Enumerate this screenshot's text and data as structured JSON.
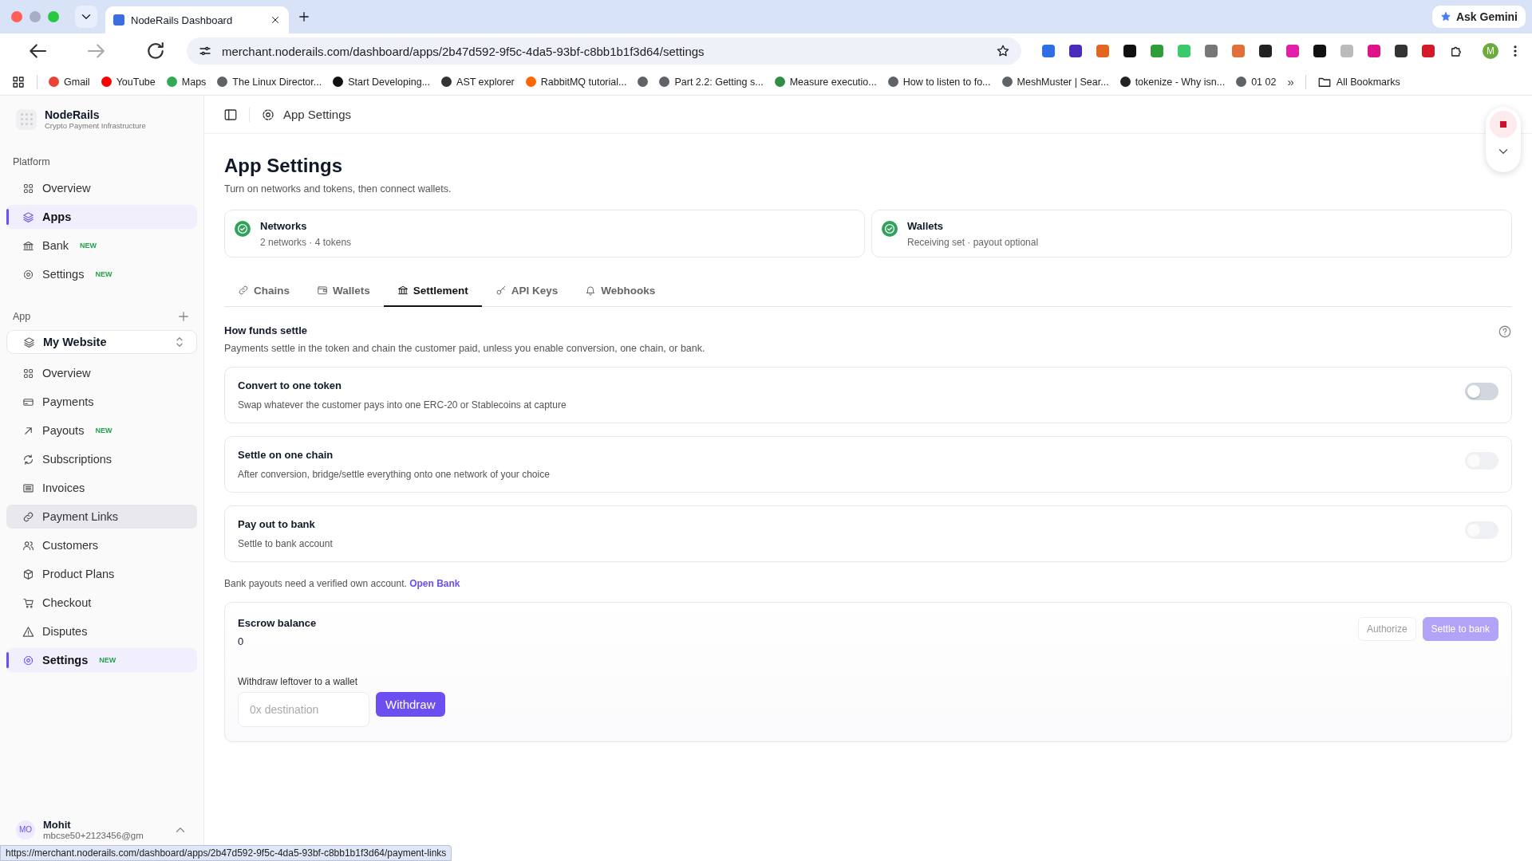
{
  "browser": {
    "tabs": [
      {
        "title": "NodeRails Dashboard",
        "selected": true
      }
    ],
    "url": "merchant.noderails.com/dashboard/apps/2b47d592-9f5c-4da5-93bf-c8bb1b1f3d64/settings",
    "ask_button": "Ask Gemini",
    "profile": "M",
    "bookmarks": [
      {
        "label": "Gmail",
        "color": "#ea4335"
      },
      {
        "label": "YouTube",
        "color": "#ff0000"
      },
      {
        "label": "Maps",
        "color": "#34a853"
      },
      {
        "label": "The Linux Director...",
        "color": "#5f6368"
      },
      {
        "label": "Start Developing...",
        "color": "#111111"
      },
      {
        "label": "AST explorer",
        "color": "#333333"
      },
      {
        "label": "RabbitMQ tutorial...",
        "color": "#ff6600"
      },
      {
        "color": "#5f6368"
      },
      {
        "label": "Part 2.2: Getting s...",
        "color": "#5f6368"
      },
      {
        "label": "Measure executio...",
        "color": "#2f8d46"
      },
      {
        "label": "How to listen to fo...",
        "color": "#5f6368"
      },
      {
        "label": "MeshMuster | Sear...",
        "color": "#5f6368"
      },
      {
        "label": "tokenize - Why isn...",
        "color": "#222222"
      },
      {
        "label": "01 02",
        "color": "#5f6368"
      }
    ],
    "overflow": "»",
    "all_bookmarks": "All Bookmarks"
  },
  "sidebar": {
    "brand": {
      "name": "NodeRails",
      "tagline": "Crypto Payment Infrastructure"
    },
    "platform": {
      "heading": "Platform",
      "items": [
        {
          "label": "Overview",
          "selected": false,
          "hovered": false
        },
        {
          "label": "Apps",
          "selected": true,
          "hovered": false
        },
        {
          "label": "Bank",
          "badge": "NEW",
          "selected": false,
          "hovered": false
        },
        {
          "label": "Settings",
          "badge": "NEW",
          "selected": false,
          "hovered": false
        }
      ]
    },
    "app": {
      "heading": "App",
      "selector": "My Website",
      "items": [
        {
          "label": "Overview",
          "selected": false,
          "hovered": false
        },
        {
          "label": "Payments",
          "selected": false,
          "hovered": false
        },
        {
          "label": "Payouts",
          "badge": "NEW",
          "selected": false,
          "hovered": false
        },
        {
          "label": "Subscriptions",
          "selected": false,
          "hovered": false
        },
        {
          "label": "Invoices",
          "selected": false,
          "hovered": false
        },
        {
          "label": "Payment Links",
          "selected": false,
          "hovered": true
        },
        {
          "label": "Customers",
          "selected": false,
          "hovered": false
        },
        {
          "label": "Product Plans",
          "selected": false,
          "hovered": false
        },
        {
          "label": "Checkout",
          "selected": false,
          "hovered": false
        },
        {
          "label": "Disputes",
          "selected": false,
          "hovered": false
        },
        {
          "label": "Settings",
          "badge": "NEW",
          "selected": true,
          "hovered": false
        }
      ]
    },
    "user": {
      "initials": "MO",
      "name": "Mohit",
      "email": "mbcse50+2123456@gm"
    }
  },
  "header": {
    "title": "App Settings"
  },
  "page": {
    "title": "App Settings",
    "subtitle": "Turn on networks and tokens, then connect wallets.",
    "status_cards": [
      {
        "title": "Networks",
        "detail": "2 networks · 4 tokens",
        "done": true
      },
      {
        "title": "Wallets",
        "detail": "Receiving set · payout optional",
        "done": true
      }
    ],
    "tabs": [
      {
        "label": "Chains",
        "selected": false
      },
      {
        "label": "Wallets",
        "selected": false
      },
      {
        "label": "Settlement",
        "selected": true
      },
      {
        "label": "API Keys",
        "selected": false
      },
      {
        "label": "Webhooks",
        "selected": false
      }
    ],
    "section": {
      "title": "How funds settle",
      "description": "Payments settle in the token and chain the customer paid, unless you enable conversion, one chain, or bank."
    },
    "options": [
      {
        "title": "Convert to one token",
        "description": "Swap whatever the customer pays into one ERC-20 or Stablecoins at capture",
        "on": false,
        "disabled": false
      },
      {
        "title": "Settle on one chain",
        "description": "After conversion, bridge/settle everything onto one network of your choice",
        "on": false,
        "disabled": true
      },
      {
        "title": "Pay out to bank",
        "description": "Settle to bank account",
        "on": false,
        "disabled": true
      }
    ],
    "bank_note": {
      "text": "Bank payouts need a verified own account.",
      "link": "Open Bank"
    },
    "escrow": {
      "title": "Escrow balance",
      "amount": "0",
      "actions": [
        {
          "label": "Authorize",
          "kind": "secondary",
          "disabled": true
        },
        {
          "label": "Settle to bank",
          "kind": "primary",
          "disabled": true
        }
      ],
      "withdraw": {
        "label": "Withdraw leftover to a wallet",
        "placeholder": "0x destination",
        "button": "Withdraw"
      }
    }
  },
  "status_url": "https://merchant.noderails.com/dashboard/apps/2b47d592-9f5c-4da5-93bf-c8bb1b1f3d64/payment-links"
}
